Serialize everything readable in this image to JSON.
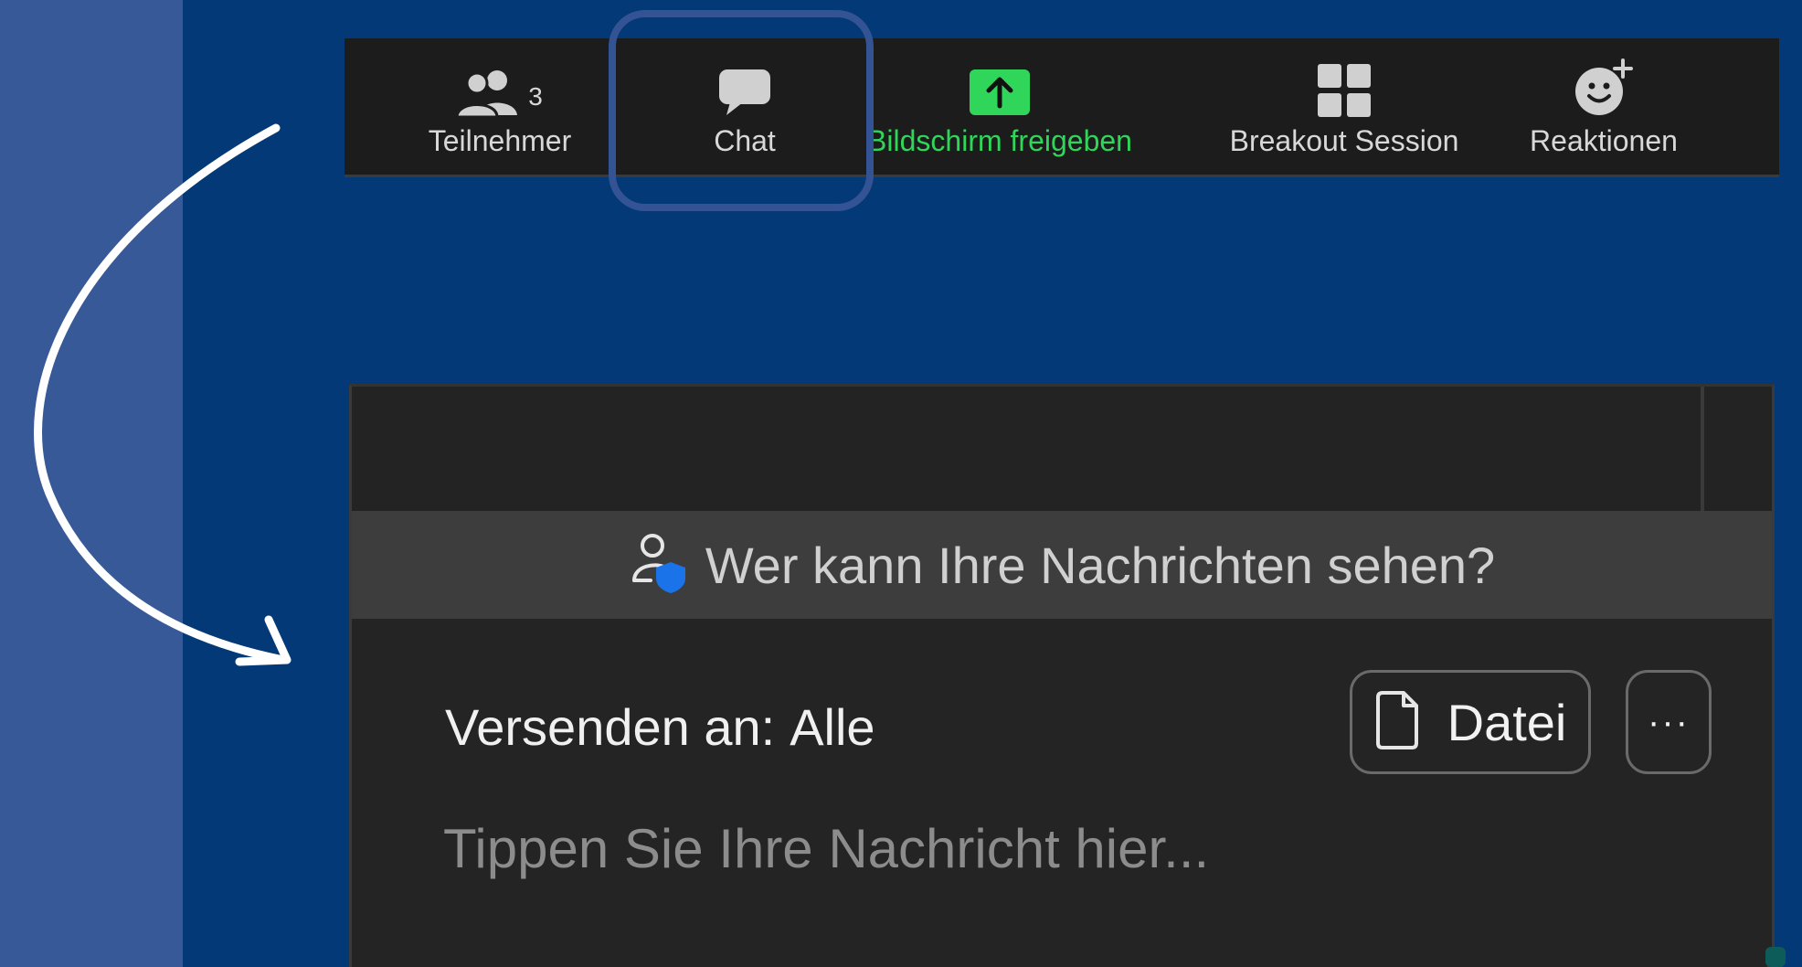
{
  "toolbar": {
    "participants": {
      "label": "Teilnehmer",
      "count": "3",
      "icon": "participants-icon"
    },
    "chat": {
      "label": "Chat",
      "icon": "chat-bubble-icon"
    },
    "share_screen": {
      "label": "Bildschirm freigeben",
      "icon": "share-screen-icon",
      "color": "#2fd65a"
    },
    "breakout": {
      "label": "Breakout Session",
      "icon": "grid-icon"
    },
    "reactions": {
      "label": "Reaktionen",
      "icon": "add-reaction-icon"
    }
  },
  "chat": {
    "privacy_notice": "Wer kann Ihre Nachrichten sehen?",
    "send_to_label": "Versenden an:",
    "send_to_value": "Alle",
    "file_button": "Datei",
    "more_button": "···",
    "input_placeholder": "Tippen Sie Ihre Nachricht hier..."
  },
  "colors": {
    "background": "#023976",
    "stripe": "#375998",
    "highlight": "#335394",
    "toolbar": "#1c1c1c",
    "panel": "#242424",
    "privacy_bar": "#3d3d3d",
    "shield": "#1a73e8"
  }
}
